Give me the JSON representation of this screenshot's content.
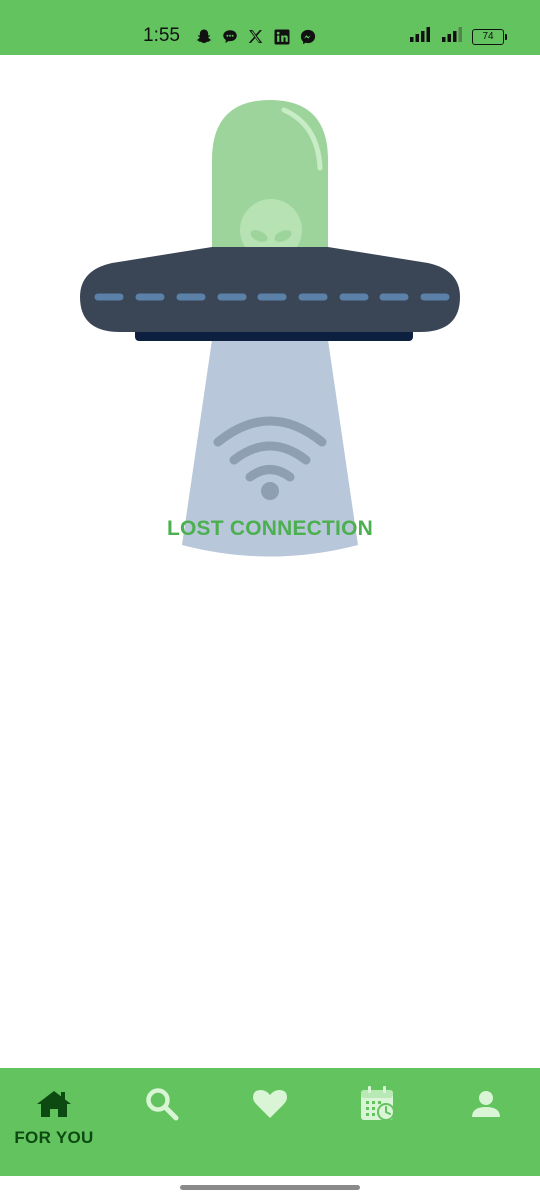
{
  "status_bar": {
    "time": "1:55",
    "battery": "74",
    "notification_icons": [
      "snapchat-icon",
      "chat-bubble-icon",
      "x-icon",
      "linkedin-icon",
      "messenger-icon"
    ],
    "background": "#63c35f"
  },
  "main": {
    "message": "LOST CONNECTION",
    "message_color": "#4caf50",
    "illustration": "ufo-wifi-lost-illustration"
  },
  "bottom_nav": {
    "background": "#63c35f",
    "items": [
      {
        "label": "FOR YOU",
        "icon": "home-icon",
        "active": true
      },
      {
        "label": "",
        "icon": "search-icon",
        "active": false
      },
      {
        "label": "",
        "icon": "heart-icon",
        "active": false
      },
      {
        "label": "",
        "icon": "calendar-clock-icon",
        "active": false
      },
      {
        "label": "",
        "icon": "person-icon",
        "active": false
      }
    ],
    "active_color": "#0d4a12",
    "inactive_color": "#d9f5d6"
  }
}
